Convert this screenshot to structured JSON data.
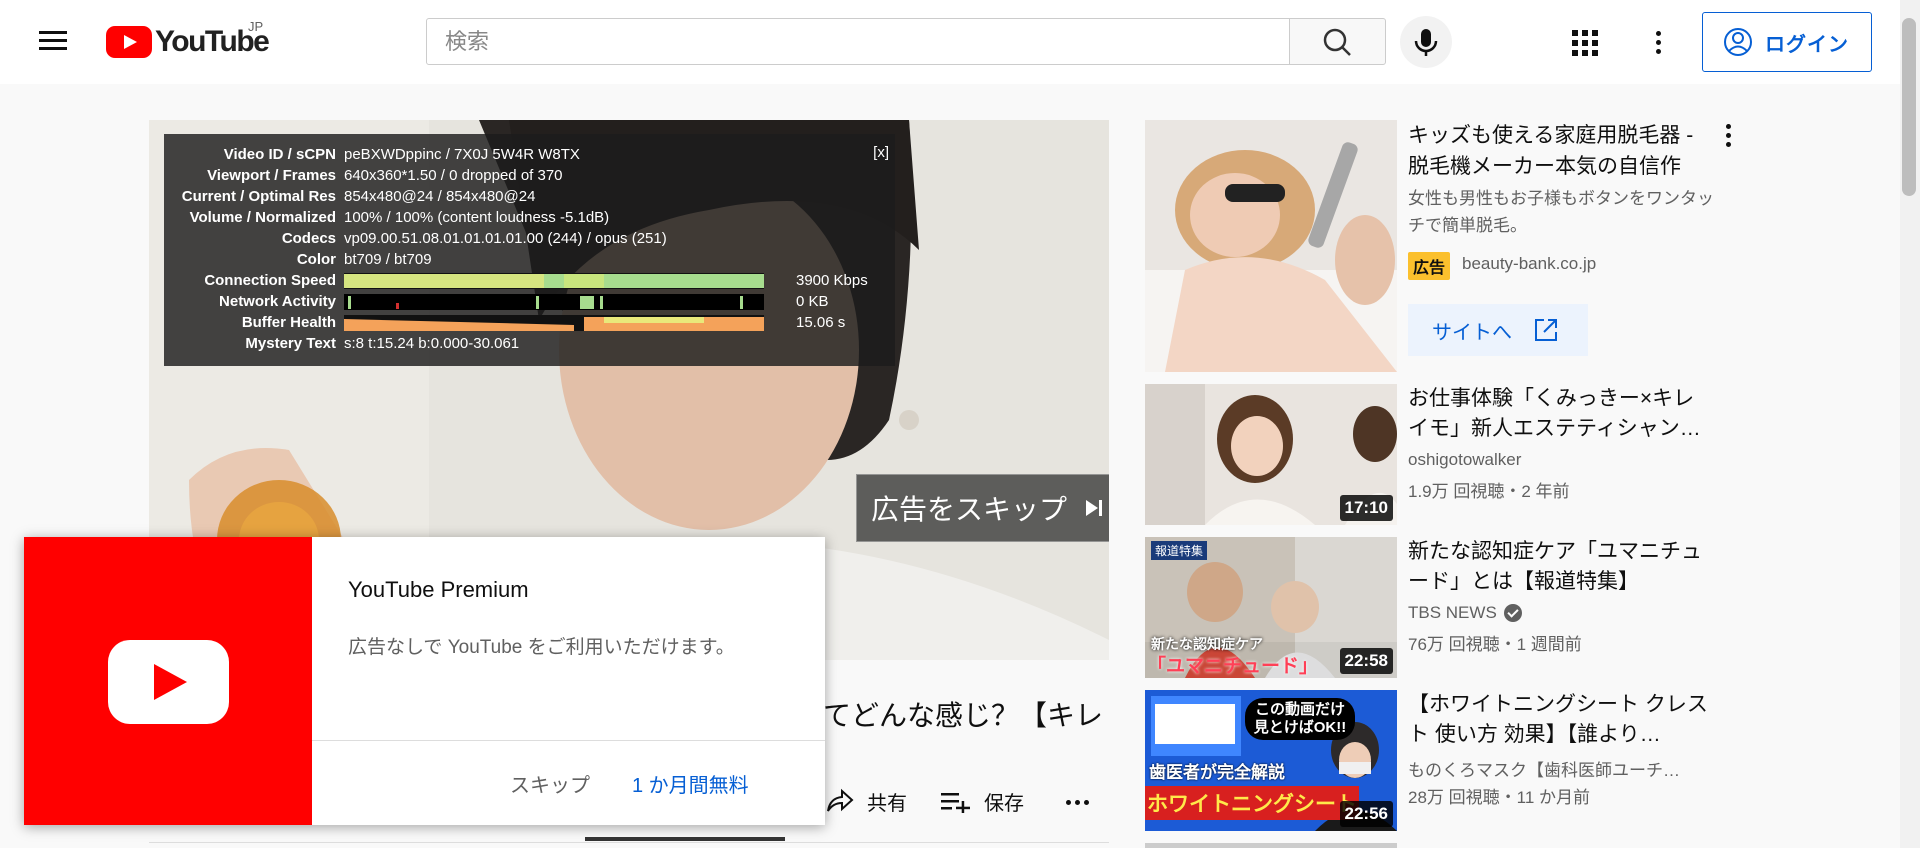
{
  "header": {
    "logo_text": "YouTube",
    "country_code": "JP",
    "search_placeholder": "検索",
    "login_label": "ログイン"
  },
  "player": {
    "stats": {
      "close_label": "[x]",
      "rows": [
        {
          "key": "Video ID / sCPN",
          "value": "peBXWDppinc / 7X0J 5W4R W8TX"
        },
        {
          "key": "Viewport / Frames",
          "value": "640x360*1.50 / 0 dropped of 370"
        },
        {
          "key": "Current / Optimal Res",
          "value": "854x480@24 / 854x480@24"
        },
        {
          "key": "Volume / Normalized",
          "value": "100% / 100% (content loudness -5.1dB)"
        },
        {
          "key": "Codecs",
          "value": "vp09.00.51.08.01.01.01.01.00 (244) / opus (251)"
        },
        {
          "key": "Color",
          "value": "bt709 / bt709"
        },
        {
          "key": "Connection Speed",
          "value": "3900 Kbps"
        },
        {
          "key": "Network Activity",
          "value": "0 KB"
        },
        {
          "key": "Buffer Health",
          "value": "15.06 s"
        },
        {
          "key": "Mystery Text",
          "value": "s:8 t:15.24 b:0.000-30.061"
        }
      ]
    },
    "skip_ad_label": "広告をスキップ"
  },
  "premium_popup": {
    "title": "YouTube Premium",
    "description": "広告なしで YouTube をご利用いただけます。",
    "skip_label": "スキップ",
    "trial_label": "1 か月間無料"
  },
  "video": {
    "title_fragment": "てどんな感じ？【キレ",
    "actions": {
      "share_label": "共有",
      "save_label": "保存"
    }
  },
  "sidebar": {
    "ad": {
      "title": "キッズも使える家庭用脱毛器 - 脱毛機メーカー本気の自信作",
      "description": "女性も男性もお子様もボタンをワンタッチで簡単脱毛。",
      "badge": "広告",
      "domain": "beauty-bank.co.jp",
      "cta_label": "サイトへ"
    },
    "videos": [
      {
        "title": "お仕事体験「くみっきー×キレイモ」新人エステティシャン…",
        "channel": "oshigotowalker",
        "meta": "1.9万 回視聴・2 年前",
        "duration": "17:10",
        "verified": false
      },
      {
        "title": "新たな認知症ケア「ユマニチュード」とは【報道特集】",
        "channel": "TBS NEWS",
        "meta": "76万 回視聴・1 週間前",
        "duration": "22:58",
        "verified": true,
        "thumb_caption": "新たな認知症ケア",
        "thumb_caption_big": "「ユマニチュード」",
        "thumb_tag": "報道特集"
      },
      {
        "title": "【ホワイトニングシート クレスト 使い方 効果】【誰より…",
        "channel": "ものくろマスク【歯科医師ユーチ…",
        "meta": "28万 回視聴・11 か月前",
        "duration": "22:56",
        "verified": false,
        "thumb_bubble": "この動画だけ見とけばOK!!",
        "thumb_line1": "歯医者が完全解説",
        "thumb_line2": "ホワイトニングシート"
      }
    ]
  }
}
